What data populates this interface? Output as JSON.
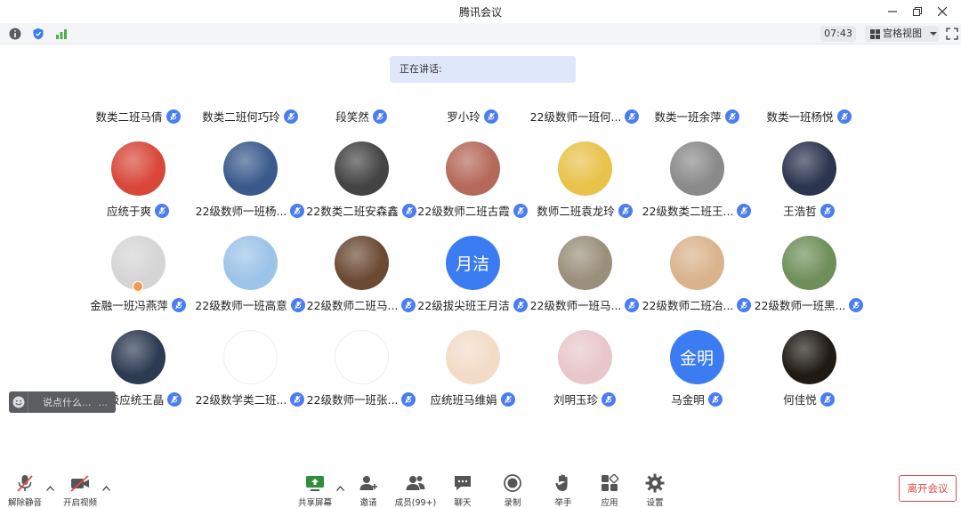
{
  "window": {
    "title": "腾讯会议"
  },
  "infobar": {
    "timer": "07:43",
    "view_label": "宫格视图"
  },
  "speaking": {
    "label": "正在讲话:"
  },
  "header_row": [
    "数类二班马倩",
    "数类二班何巧玲",
    "段笑然",
    "罗小玲",
    "22级数师一班何...",
    "数类一班余萍",
    "数类一班杨悦"
  ],
  "participants": [
    {
      "name": "应统于爽",
      "avatar_color": "#d8473a"
    },
    {
      "name": "22级数师一班杨...",
      "avatar_color": "#3a5a8c"
    },
    {
      "name": "22数类二班安森鑫",
      "avatar_color": "#444444"
    },
    {
      "name": "22级数师二班古霞",
      "avatar_color": "#b5695a"
    },
    {
      "name": "数师二班袁龙玲",
      "avatar_color": "#e8c24a"
    },
    {
      "name": "22级数类二班王...",
      "avatar_color": "#8a8a8a"
    },
    {
      "name": "王浩哲",
      "avatar_color": "#2c3550"
    },
    {
      "name": "金融一班冯燕萍",
      "avatar_color": "#d5d5d5",
      "badge": true
    },
    {
      "name": "22级数师一班高意",
      "avatar_color": "#9cc3e8"
    },
    {
      "name": "22级数师二班马...",
      "avatar_color": "#6b4a34"
    },
    {
      "name": "22级拔尖班王月洁",
      "avatar_color": "#3b7cf2",
      "avatar_text": "月洁"
    },
    {
      "name": "22级数师一班马...",
      "avatar_color": "#9a8f7a"
    },
    {
      "name": "22级数师二班冶...",
      "avatar_color": "#d9b38c"
    },
    {
      "name": "22级数师一班黑...",
      "avatar_color": "#6e8f5a"
    },
    {
      "name": "22级应统王晶",
      "avatar_color": "#2d3b52"
    },
    {
      "name": "22级数学类二班...",
      "avatar_color": "#ffffff"
    },
    {
      "name": "22级数师一班张...",
      "avatar_color": "#ffffff"
    },
    {
      "name": "应统班马维娟",
      "avatar_color": "#f2dcc8"
    },
    {
      "name": "刘明玉珍",
      "avatar_color": "#e8c7cc"
    },
    {
      "name": "马金明",
      "avatar_color": "#3b7cf2",
      "avatar_text": "金明"
    },
    {
      "name": "何佳悦",
      "avatar_color": "#1f1a14"
    }
  ],
  "chat": {
    "placeholder": "说点什么...",
    "more": "..."
  },
  "toolbar": {
    "unmute": "解除静音",
    "start_video": "开启视频",
    "share_screen": "共享屏幕",
    "invite": "邀请",
    "members": "成员(99+)",
    "chat": "聊天",
    "record": "录制",
    "raise_hand": "举手",
    "apps": "应用",
    "settings": "设置",
    "leave": "离开会议"
  },
  "colors": {
    "accent": "#4a7df2",
    "leave": "#e04b4b",
    "speaking_bg": "#dfe8fa"
  }
}
